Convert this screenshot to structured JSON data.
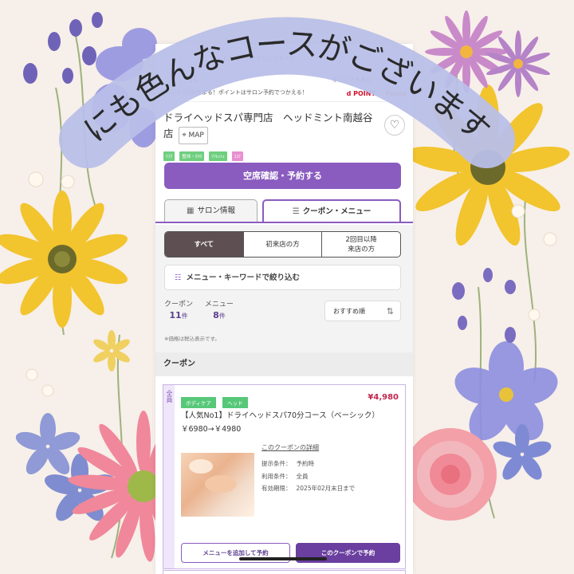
{
  "banner": {
    "text": "他にも色んなコースがございます！"
  },
  "top_strip": {
    "line1": "ヘッドスパ・ヘアサロンのサイト",
    "line2": "さん",
    "line3": "ポイントが2%たまる！ポイントはサロン予約でつかえる！",
    "right_label": "ポイントを表示",
    "dpoint": "d POINT",
    "ponta": "Ponta"
  },
  "salon": {
    "name": "ドライヘッドスパ専門店　ヘッドミント南越谷店",
    "map_label": "MAP",
    "tags": [
      "ﾘﾗｸ",
      "整体・ｶｲﾛ",
      "ﾘﾌﾚｯｼｭ",
      "ｴｽﾃ"
    ],
    "reserve_button": "空席確認・予約する"
  },
  "tabs": {
    "salon_info": "サロン情報",
    "coupon_menu": "クーポン・メニュー"
  },
  "segments": [
    "すべて",
    "初来店の方",
    "2回目以降\n来店の方"
  ],
  "filter": {
    "label": "メニュー・キーワードで絞り込む"
  },
  "counts": {
    "coupon_label": "クーポン",
    "coupon_value": "11",
    "menu_label": "メニュー",
    "menu_value": "8",
    "unit": "件"
  },
  "sort": {
    "label": "おすすめ順"
  },
  "tax_note": "※価格は税込表示です。",
  "coupon_section": {
    "heading": "クーポン"
  },
  "coupon": {
    "side_label": "全員",
    "tags": [
      "ボディケア",
      "ヘッド"
    ],
    "price": "¥4,980",
    "title": "【人気No1】ドライヘッドスパ70分コース（ベーシック）￥6980→￥4980",
    "details_link": "このクーポンの詳細",
    "conditions_label": "提示条件：",
    "conditions_value": "予約時",
    "usage_label": "利用条件：",
    "usage_value": "全員",
    "expiry_label": "有効期限：",
    "expiry_value": "2025年02月末日まで",
    "add_menu_button": "メニューを追加して予約",
    "reserve_button": "このクーポンで予約"
  },
  "colors": {
    "accent": "#8a5cbf",
    "banner": "#b8bfe8",
    "price": "#c0284e",
    "tag_green": "#56c878"
  }
}
